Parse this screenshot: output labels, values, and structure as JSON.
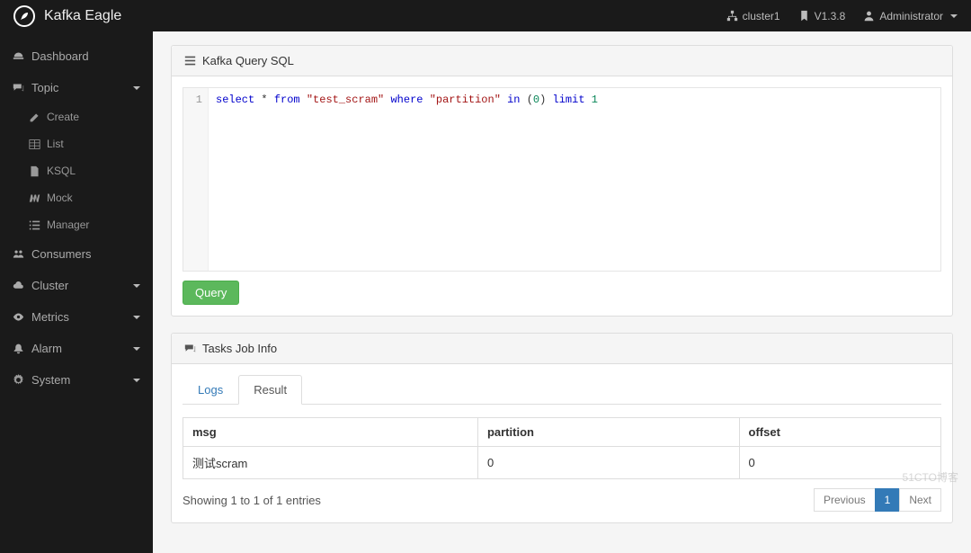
{
  "brand": "Kafka Eagle",
  "top": {
    "cluster": "cluster1",
    "version": "V1.3.8",
    "user": "Administrator"
  },
  "nav": {
    "dashboard": "Dashboard",
    "topic": "Topic",
    "topic_sub": {
      "create": "Create",
      "list": "List",
      "ksql": "KSQL",
      "mock": "Mock",
      "manager": "Manager"
    },
    "consumers": "Consumers",
    "cluster": "Cluster",
    "metrics": "Metrics",
    "alarm": "Alarm",
    "system": "System"
  },
  "query_panel": {
    "title": "Kafka Query SQL",
    "gutter": "1",
    "tokens": {
      "select": "select",
      "star": "*",
      "from": "from",
      "tbl": "\"test_scram\"",
      "where": "where",
      "col": "\"partition\"",
      "in": "in",
      "lp": "(",
      "zero": "0",
      "rp": ")",
      "limit": "limit",
      "one": "1"
    },
    "button": "Query"
  },
  "tasks_panel": {
    "title": "Tasks Job Info",
    "tabs": {
      "logs": "Logs",
      "result": "Result"
    },
    "columns": {
      "msg": "msg",
      "partition": "partition",
      "offset": "offset"
    },
    "rows": [
      {
        "msg": "测试scram",
        "partition": "0",
        "offset": "0"
      }
    ],
    "info": "Showing 1 to 1 of 1 entries",
    "pager": {
      "prev": "Previous",
      "page": "1",
      "next": "Next"
    }
  },
  "watermark": "51CTO博客"
}
